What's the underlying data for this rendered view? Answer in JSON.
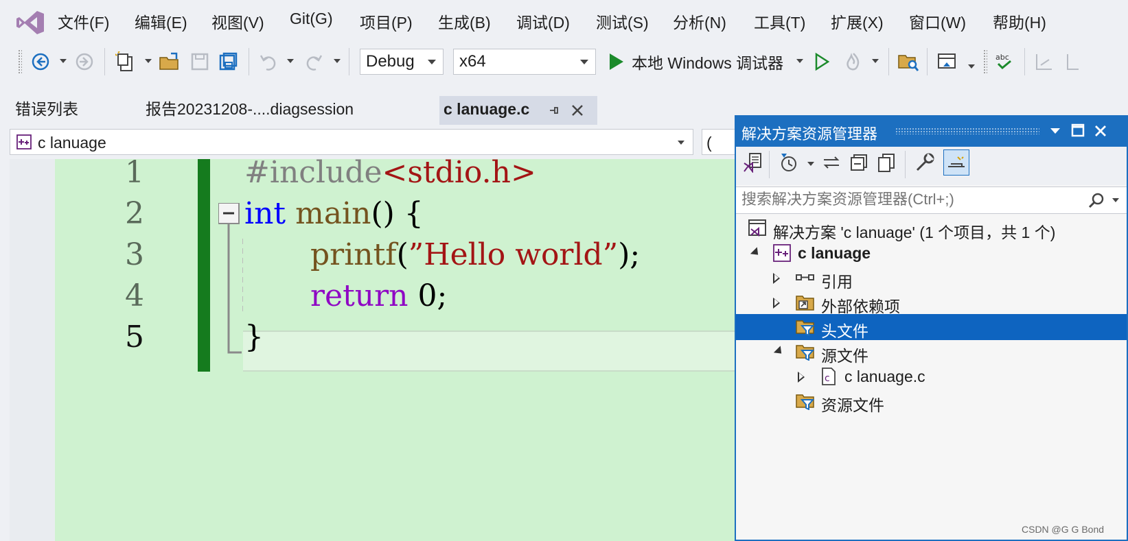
{
  "menu": {
    "items": [
      {
        "label": "文件(F)"
      },
      {
        "label": "编辑(E)"
      },
      {
        "label": "视图(V)"
      },
      {
        "label": "Git(G)"
      },
      {
        "label": "项目(P)"
      },
      {
        "label": "生成(B)"
      },
      {
        "label": "调试(D)"
      },
      {
        "label": "测试(S)"
      },
      {
        "label": "分析(N)"
      },
      {
        "label": "工具(T)"
      },
      {
        "label": "扩展(X)"
      },
      {
        "label": "窗口(W)"
      },
      {
        "label": "帮助(H)"
      }
    ]
  },
  "toolbar": {
    "config": "Debug",
    "platform": "x64",
    "run_label": "本地 Windows 调试器",
    "run_color": "#1b8a2b"
  },
  "tabs": [
    {
      "label": "错误列表"
    },
    {
      "label": "报告20231208-....diagsession"
    },
    {
      "label": "c lanuage.c"
    }
  ],
  "navbar": {
    "project": "c lanuage",
    "right_partial": "("
  },
  "editor": {
    "line_numbers": [
      "1",
      "2",
      "3",
      "4",
      "5"
    ],
    "lines": [
      {
        "parts": [
          {
            "t": "#include",
            "c": "#808080"
          },
          {
            "t": "<stdio.h>",
            "c": "#a31515"
          }
        ]
      },
      {
        "parts": [
          {
            "t": "int",
            "c": "#0000ff"
          },
          {
            "t": " ",
            "c": "#000000"
          },
          {
            "t": "main",
            "c": "#74531f"
          },
          {
            "t": "() {",
            "c": "#000000"
          }
        ]
      },
      {
        "parts": [
          {
            "t": "printf",
            "c": "#74531f"
          },
          {
            "t": "(",
            "c": "#000000"
          },
          {
            "t": "”Hello world”",
            "c": "#a31515"
          },
          {
            "t": ");",
            "c": "#000000"
          }
        ]
      },
      {
        "parts": [
          {
            "t": "return",
            "c": "#8f08c4"
          },
          {
            "t": " 0;",
            "c": "#000000"
          }
        ]
      },
      {
        "parts": [
          {
            "t": "}",
            "c": "#000000"
          }
        ]
      }
    ],
    "background": "#cff2d0"
  },
  "solution_explorer": {
    "title": "解决方案资源管理器",
    "search_placeholder": "搜索解决方案资源管理器(Ctrl+;)",
    "tree": [
      {
        "label": "解决方案 'c lanuage' (1 个项目，共 1 个)",
        "icon": "solution-icon"
      },
      {
        "label": "c lanuage",
        "icon": "project-icon",
        "bold": true
      },
      {
        "label": "引用",
        "icon": "references-icon"
      },
      {
        "label": "外部依赖项",
        "icon": "external-deps-icon"
      },
      {
        "label": "头文件",
        "icon": "filter-folder-icon",
        "selected": true
      },
      {
        "label": "源文件",
        "icon": "filter-folder-icon"
      },
      {
        "label": "c lanuage.c",
        "icon": "c-file-icon"
      },
      {
        "label": "资源文件",
        "icon": "filter-folder-icon"
      }
    ],
    "accent": "#1c6fc0"
  },
  "watermark": "CSDN @G  G  Bond"
}
